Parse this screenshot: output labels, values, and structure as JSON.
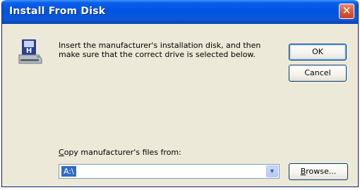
{
  "window": {
    "title": "Install From Disk",
    "close_label": "✕"
  },
  "message": {
    "text": "Insert the manufacturer's installation disk, and then make sure that the correct drive is selected below."
  },
  "buttons": {
    "ok": "OK",
    "cancel": "Cancel",
    "browse_first": "B",
    "browse_rest": "rowse..."
  },
  "copy_from": {
    "label_first": "C",
    "label_rest": "opy manufacturer's files from:",
    "value": "A:\\"
  },
  "icons": {
    "disk": "floppy-disk-drive-icon",
    "dropdown": "chevron-down-icon"
  },
  "colors": {
    "titlebar": "#0054e3",
    "dialog_bg": "#ece9d8",
    "selection": "#316ac5",
    "close_button": "#dc5e3d"
  }
}
